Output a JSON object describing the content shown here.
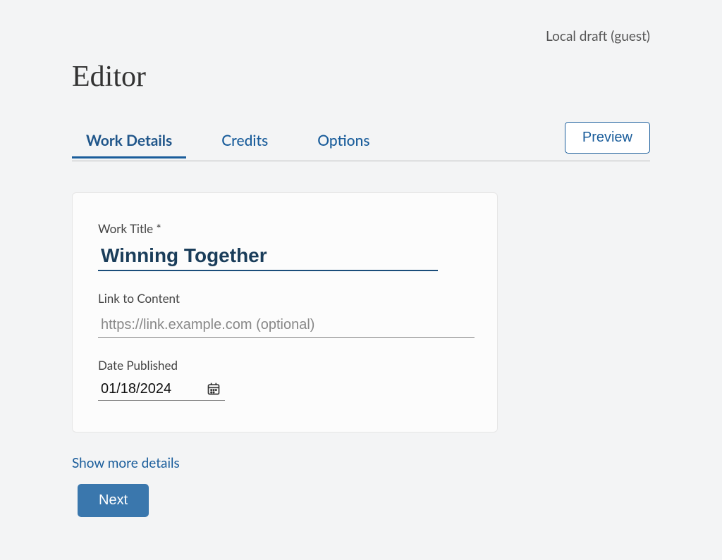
{
  "header": {
    "draft_status": "Local draft (guest)",
    "page_title": "Editor"
  },
  "tabs": {
    "work_details": "Work Details",
    "credits": "Credits",
    "options": "Options"
  },
  "buttons": {
    "preview": "Preview",
    "next": "Next"
  },
  "form": {
    "work_title_label": "Work Title *",
    "work_title_value": "Winning Together",
    "link_label": "Link to Content",
    "link_placeholder": "https://link.example.com (optional)",
    "link_value": "",
    "date_label": "Date Published",
    "date_value": "01/18/2024"
  },
  "links": {
    "show_more": "Show more details"
  }
}
